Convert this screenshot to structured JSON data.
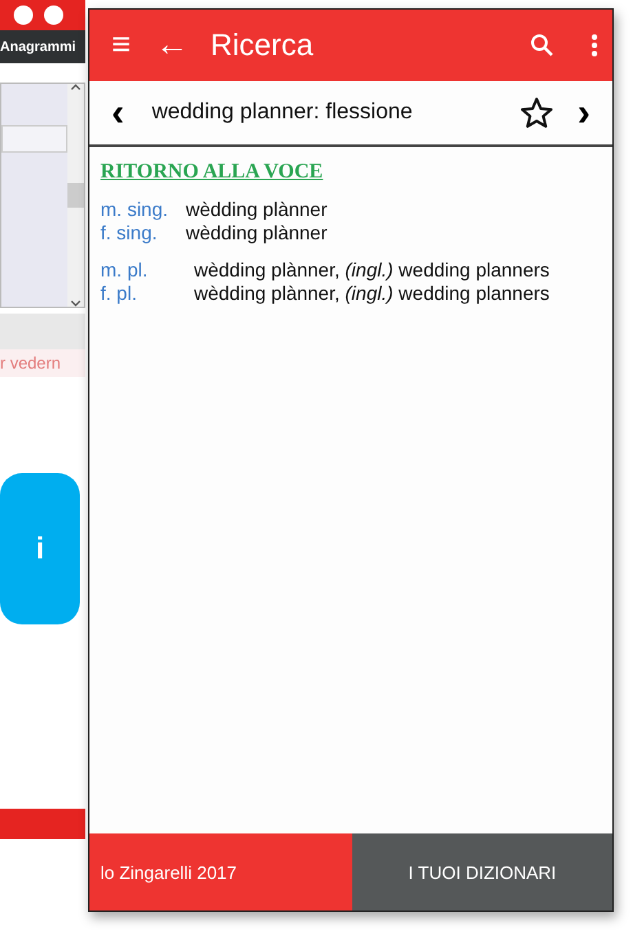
{
  "back_app": {
    "tab": "Anagrammi",
    "hint": "r vedern",
    "button": "i"
  },
  "app_bar": {
    "menu": "≡",
    "back": "←",
    "title": "Ricerca"
  },
  "entry_bar": {
    "prev": "‹",
    "title": "wedding planner: flessione",
    "starred": false,
    "next": "›"
  },
  "return_link": "RITORNO ALLA VOCE",
  "groups": [
    {
      "rows": [
        {
          "label": "m. sing.",
          "forms": "wèdding plànner"
        },
        {
          "label": "f. sing.",
          "forms": "wèdding plànner"
        }
      ]
    },
    {
      "rows": [
        {
          "label": "m. pl.",
          "forms": "wèdding plànner, *(ingl.)* wedding planners"
        },
        {
          "label": "f. pl.",
          "forms": "wèdding plànner, *(ingl.)* wedding planners"
        }
      ]
    }
  ],
  "bottom_tabs": [
    {
      "label": "lo Zingarelli 2017",
      "selected": true
    },
    {
      "label": "I TUOI DIZIONARI",
      "selected": false
    }
  ]
}
